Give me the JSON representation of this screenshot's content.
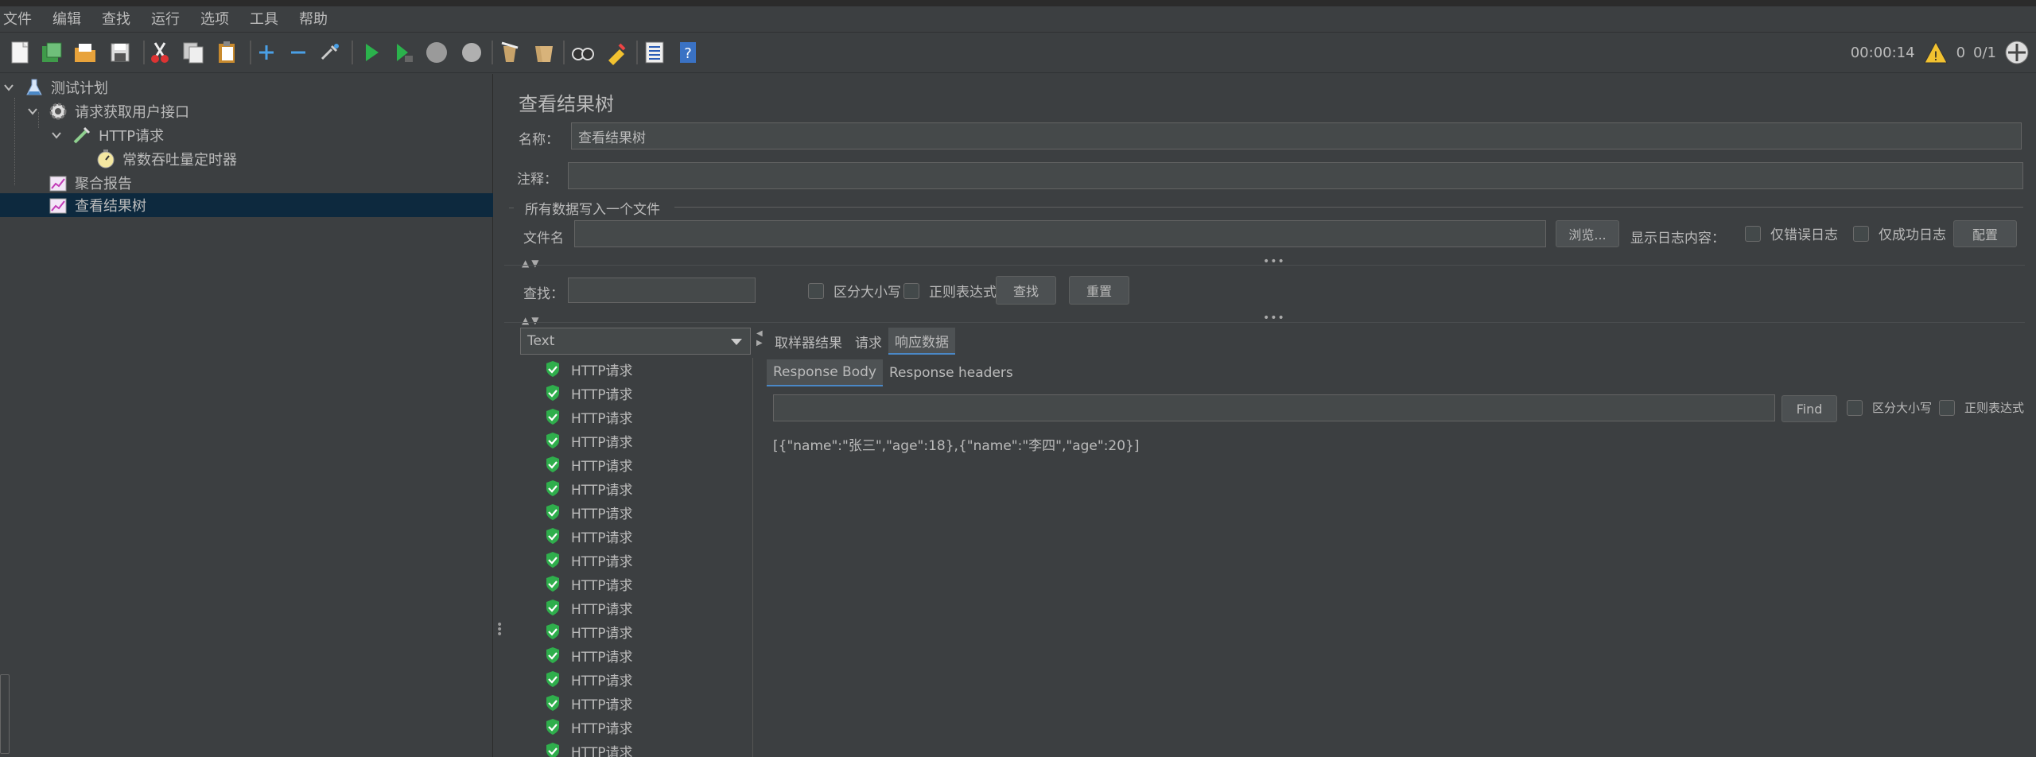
{
  "menu": [
    "文件",
    "编辑",
    "查找",
    "运行",
    "选项",
    "工具",
    "帮助"
  ],
  "toolbar": {
    "icons": [
      "new-icon",
      "templates-icon",
      "open-icon",
      "save-icon",
      "cut-icon",
      "copy-icon",
      "paste-icon",
      "expand-icon",
      "collapse-icon",
      "toggle-icon",
      "start-icon",
      "start-no-pause-icon",
      "stop-icon",
      "shutdown-icon",
      "clear-icon",
      "clear-all-icon",
      "search-icon",
      "reset-search-icon",
      "function-helper-icon",
      "help-icon"
    ],
    "timer": "00:00:14",
    "warnings": "0",
    "threads": "0/1"
  },
  "tree": {
    "nodes": [
      {
        "label": "测试计划",
        "icon": "flask-icon"
      },
      {
        "label": "请求获取用户接口",
        "icon": "gear-icon"
      },
      {
        "label": "HTTP请求",
        "icon": "pipette-icon"
      },
      {
        "label": "常数吞吐量定时器",
        "icon": "timer-icon"
      },
      {
        "label": "聚合报告",
        "icon": "report-icon"
      },
      {
        "label": "查看结果树",
        "icon": "report-icon"
      }
    ]
  },
  "panel": {
    "title": "查看结果树",
    "name_label": "名称：",
    "name_value": "查看结果树",
    "comment_label": "注释：",
    "comment_value": "",
    "file_group": "所有数据写入一个文件",
    "filename_label": "文件名",
    "filename_value": "",
    "browse": "浏览...",
    "log_label": "显示日志内容：",
    "errors_only": "仅错误日志",
    "success_only": "仅成功日志",
    "config": "配置",
    "search_label": "查找：",
    "search_value": "",
    "case_sensitive": "区分大小写",
    "regex": "正则表达式",
    "find_btn": "查找",
    "reset_btn": "重置"
  },
  "results": {
    "renderer": "Text",
    "items": [
      "HTTP请求",
      "HTTP请求",
      "HTTP请求",
      "HTTP请求",
      "HTTP请求",
      "HTTP请求",
      "HTTP请求",
      "HTTP请求",
      "HTTP请求",
      "HTTP请求",
      "HTTP请求",
      "HTTP请求",
      "HTTP请求",
      "HTTP请求",
      "HTTP请求",
      "HTTP请求",
      "HTTP请求"
    ],
    "tabs": [
      "取样器结果",
      "请求",
      "响应数据"
    ],
    "active_tab": "响应数据",
    "subtabs": [
      "Response Body",
      "Response headers"
    ],
    "find_value": "",
    "find_btn": "Find",
    "case_sensitive": "区分大小写",
    "regex": "正则表达式",
    "body": "[{\"name\":\"张三\",\"age\":18},{\"name\":\"李四\",\"age\":20}]"
  }
}
